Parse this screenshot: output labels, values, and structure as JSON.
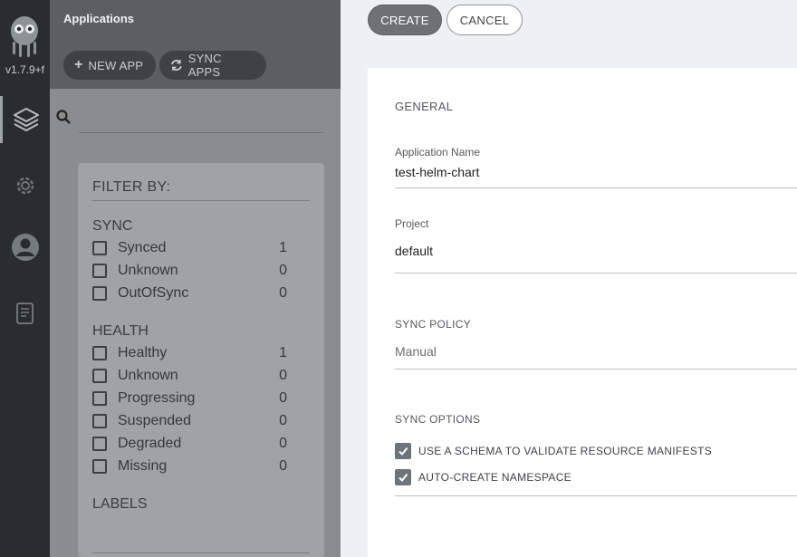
{
  "nav": {
    "version": "v1.7.9+f",
    "items": [
      {
        "icon": "layers-icon"
      },
      {
        "icon": "gear-icon"
      },
      {
        "icon": "user-icon"
      },
      {
        "icon": "docs-icon"
      }
    ]
  },
  "apps": {
    "title": "Applications",
    "new_app_label": "NEW APP",
    "sync_apps_label": "SYNC APPS",
    "search_placeholder": ""
  },
  "filter": {
    "title": "FILTER BY:",
    "sync": {
      "heading": "SYNC",
      "items": [
        {
          "label": "Synced",
          "count": "1"
        },
        {
          "label": "Unknown",
          "count": "0"
        },
        {
          "label": "OutOfSync",
          "count": "0"
        }
      ]
    },
    "health": {
      "heading": "HEALTH",
      "items": [
        {
          "label": "Healthy",
          "count": "1"
        },
        {
          "label": "Unknown",
          "count": "0"
        },
        {
          "label": "Progressing",
          "count": "0"
        },
        {
          "label": "Suspended",
          "count": "0"
        },
        {
          "label": "Degraded",
          "count": "0"
        },
        {
          "label": "Missing",
          "count": "0"
        }
      ]
    },
    "labels_heading": "LABELS"
  },
  "panel": {
    "create_label": "CREATE",
    "cancel_label": "CANCEL",
    "general_heading": "GENERAL",
    "app_name_label": "Application Name",
    "app_name_value": "test-helm-chart",
    "project_label": "Project",
    "project_value": "default",
    "sync_policy_heading": "SYNC POLICY",
    "sync_policy_value": "Manual",
    "sync_options_heading": "SYNC OPTIONS",
    "options": [
      {
        "label": "USE A SCHEMA TO VALIDATE RESOURCE MANIFESTS",
        "checked": true
      },
      {
        "label": "AUTO-CREATE NAMESPACE",
        "checked": true
      }
    ]
  },
  "colors": {
    "nav_bg": "#2a2d30",
    "primary_button": "#6d7176",
    "panel_bg": "#eef1f3"
  }
}
